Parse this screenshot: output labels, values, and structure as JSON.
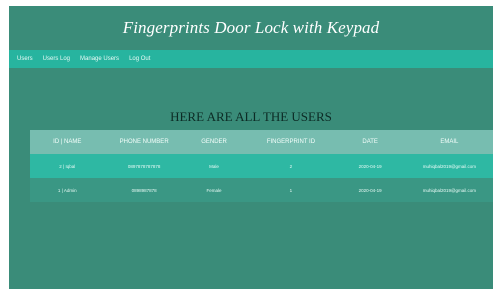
{
  "header": {
    "title": "Fingerprints Door Lock with Keypad"
  },
  "nav": {
    "items": [
      {
        "label": "Users"
      },
      {
        "label": "Users Log"
      },
      {
        "label": "Manage Users"
      },
      {
        "label": "Log Out"
      }
    ]
  },
  "main": {
    "heading": "HERE ARE ALL THE USERS",
    "table": {
      "columns": [
        "ID | NAME",
        "PHONE NUMBER",
        "GENDER",
        "FINGERPRINT ID",
        "DATE",
        "EMAIL"
      ],
      "rows": [
        {
          "id_name": "2 | Iqbal",
          "phone": "0897878787878",
          "gender": "Male",
          "fingerprint_id": "2",
          "date": "2020-04-19",
          "email": "muhiqbal2019@gmail.com"
        },
        {
          "id_name": "1 | Admin",
          "phone": "0898987878",
          "gender": "Female",
          "fingerprint_id": "1",
          "date": "2020-04-19",
          "email": "muhiqbal2019@gmail.com"
        }
      ]
    }
  },
  "colors": {
    "page_bg": "#3a8c79",
    "nav_bg": "#27b49f",
    "table_header_bg": "#77bdb0",
    "row_highlight_bg": "#2eb8a3",
    "row_alt_bg": "#3a9784"
  }
}
